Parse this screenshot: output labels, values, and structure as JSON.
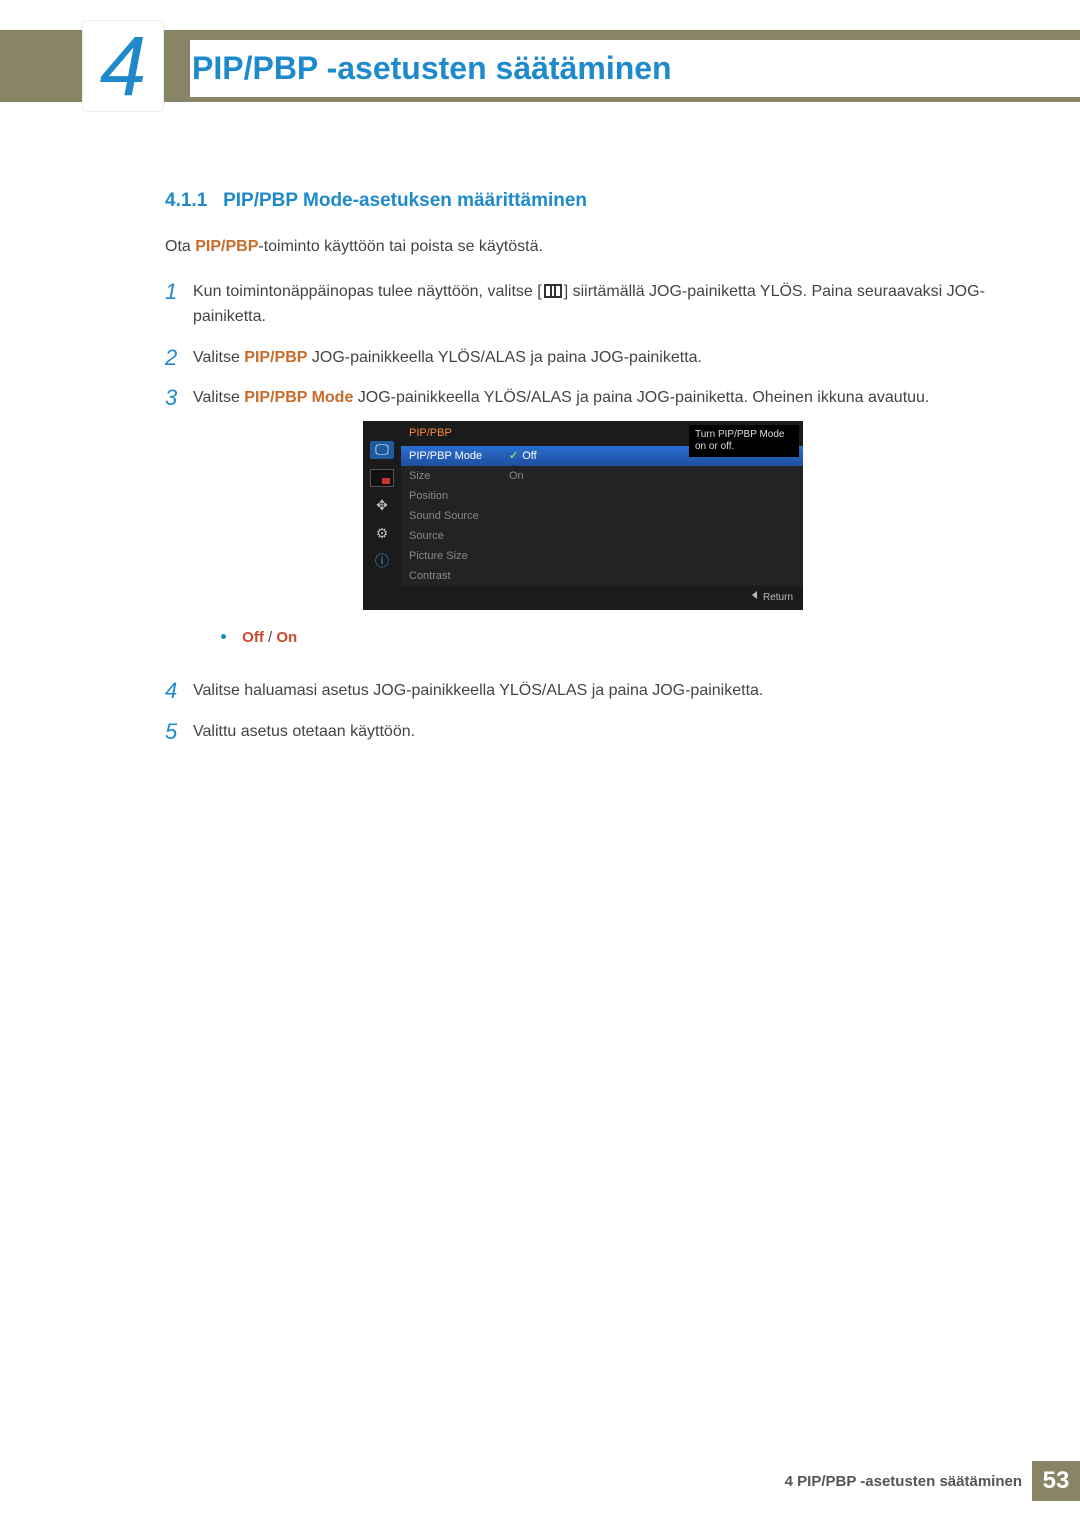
{
  "chapter": {
    "number": "4",
    "title": "PIP/PBP -asetusten säätäminen"
  },
  "section": {
    "number": "4.1.1",
    "title": "PIP/PBP Mode-asetuksen määrittäminen"
  },
  "intro": {
    "prefix": "Ota ",
    "hl": "PIP/PBP",
    "suffix": "-toiminto käyttöön tai poista se käytöstä."
  },
  "steps": {
    "s1": {
      "num": "1",
      "pre": "Kun toimintonäppäinopas tulee näyttöön, valitse [",
      "post": "] siirtämällä JOG-painiketta YLÖS. Paina seuraavaksi JOG-painiketta."
    },
    "s2": {
      "num": "2",
      "pre": "Valitse ",
      "hl": "PIP/PBP",
      "post": " JOG-painikkeella YLÖS/ALAS ja paina JOG-painiketta."
    },
    "s3": {
      "num": "3",
      "pre": "Valitse ",
      "hl": "PIP/PBP Mode",
      "post": " JOG-painikkeella YLÖS/ALAS ja paina JOG-painiketta. Oheinen ikkuna avautuu."
    },
    "s4": {
      "num": "4",
      "text": "Valitse haluamasi asetus JOG-painikkeella YLÖS/ALAS ja paina JOG-painiketta."
    },
    "s5": {
      "num": "5",
      "text": "Valittu asetus otetaan käyttöön."
    }
  },
  "bullet": {
    "off": "Off",
    "sep": " / ",
    "on": "On"
  },
  "osd": {
    "title": "PIP/PBP",
    "tooltip": "Turn PIP/PBP Mode on or off.",
    "return": "Return",
    "rows": {
      "mode": {
        "label": "PIP/PBP Mode",
        "value": "Off"
      },
      "size": {
        "label": "Size",
        "value": "On"
      },
      "pos": {
        "label": "Position",
        "value": ""
      },
      "sound": {
        "label": "Sound Source",
        "value": ""
      },
      "source": {
        "label": "Source",
        "value": ""
      },
      "psize": {
        "label": "Picture Size",
        "value": ""
      },
      "contr": {
        "label": "Contrast",
        "value": ""
      }
    }
  },
  "footer": {
    "text": "4 PIP/PBP -asetusten säätäminen",
    "page": "53"
  }
}
